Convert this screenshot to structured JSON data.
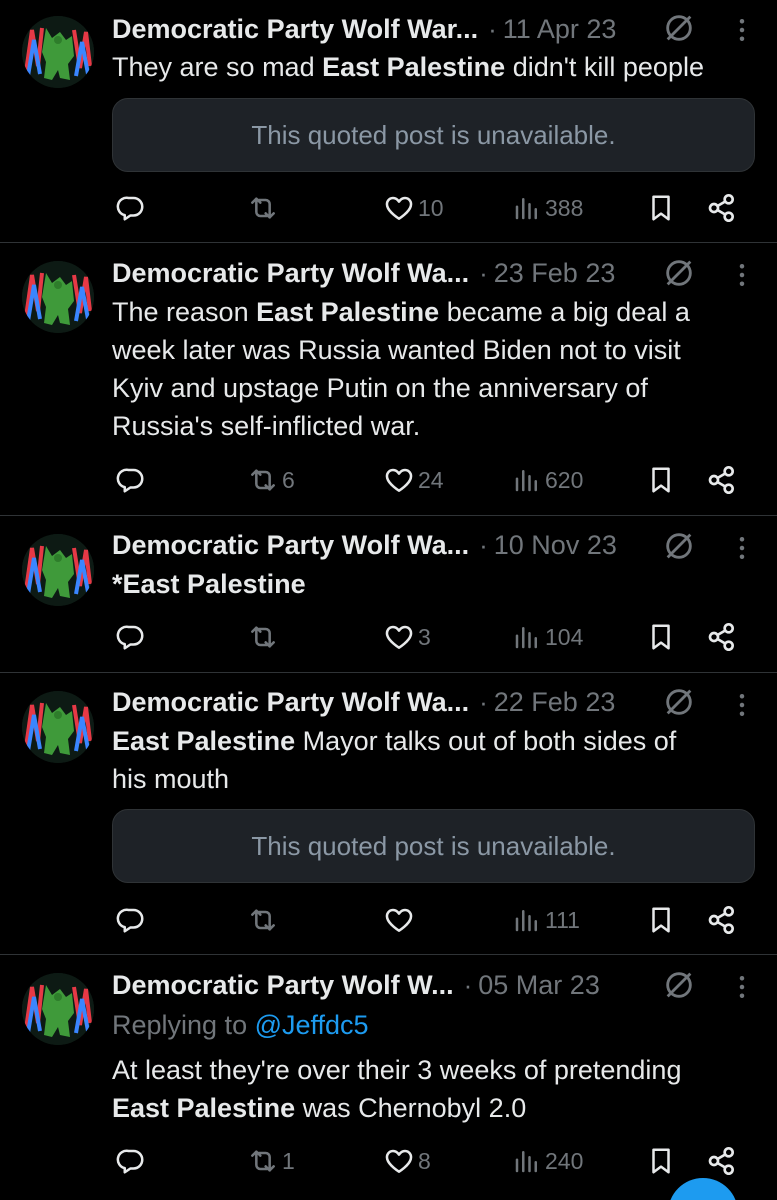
{
  "posts": [
    {
      "author": "Democratic Party Wolf War...",
      "date": "11 Apr 23",
      "text_before": "They are so mad ",
      "text_bold": "East Palestine",
      "text_after": " didn't kill people",
      "quote": "This quoted post is unavailable.",
      "reposts": "",
      "likes": "10",
      "views": "388"
    },
    {
      "author": "Democratic Party Wolf Wa...",
      "date": "23 Feb 23",
      "text_line1_before": "The reason ",
      "text_line1_bold": "East Palestine",
      "text_line1_after": " became a big deal a",
      "text_line2": "week later was Russia wanted Biden not to visit",
      "text_line3": "Kyiv and upstage Putin on the anniversary of",
      "text_line4": "Russia's self-inflicted war.",
      "reposts": "6",
      "likes": "24",
      "views": "620"
    },
    {
      "author": "Democratic Party Wolf Wa...",
      "date": "10 Nov 23",
      "text": "*East Palestine",
      "reposts": "",
      "likes": "3",
      "views": "104"
    },
    {
      "author": "Democratic Party Wolf Wa...",
      "date": "22 Feb 23",
      "text_bold": "East Palestine",
      "text_after": " Mayor talks out of both sides of",
      "text_line2": "his mouth",
      "quote": "This quoted post is unavailable.",
      "reposts": "",
      "likes": "",
      "views": "111"
    },
    {
      "author": "Democratic Party Wolf W...",
      "date": "05 Mar 23",
      "replying_label": "Replying to ",
      "replying_handle": "@Jeffdc5",
      "text_line1": "At least they're over their 3 weeks of pretending",
      "text_bold": "East Palestine",
      "text_after": " was Chernobyl 2.0",
      "reposts": "1",
      "likes": "8",
      "views": "240"
    }
  ],
  "header_separator": "·",
  "colors": {
    "background": "#000000",
    "text": "#e7e9ea",
    "muted": "#71767b",
    "link": "#1d9bf0",
    "divider": "#2f3336",
    "quote_bg": "#1e2227"
  },
  "icons": [
    "reply-icon",
    "repost-icon",
    "like-icon",
    "views-icon",
    "bookmark-icon",
    "share-icon",
    "more-icon",
    "no-sign-icon"
  ]
}
